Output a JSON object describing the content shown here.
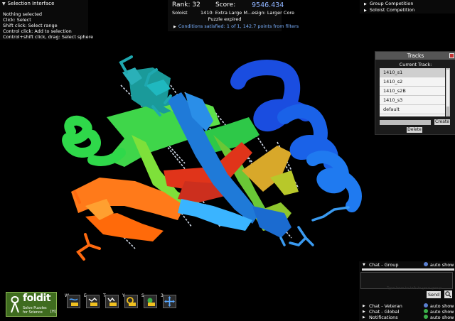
{
  "selection": {
    "title": "Selection Interface",
    "lines": [
      "Nothing selected",
      "Click: Select",
      "Shift click: Select range",
      "Control click: Add to selection",
      "Control+shift click, drag: Select sphere"
    ]
  },
  "score": {
    "rank": "Rank: 32",
    "label": "Score:",
    "value": "9546.434",
    "mode": "Soloist",
    "puzzle": "1410: Extra Large M...esign: Larger Core",
    "status": "Puzzle expired",
    "conditions": "Conditions satisfied: 1 of 1, 142.7 points from filters"
  },
  "competition": {
    "items": [
      "Group Competition",
      "Soloist Competition"
    ]
  },
  "tracks": {
    "title": "Tracks",
    "current_label": "Current Track:",
    "items": [
      "1410_s1",
      "1410_s2",
      "1410_s2B",
      "1410_s3",
      "default"
    ],
    "create_label": "Create",
    "delete_label": "Delete"
  },
  "chat": {
    "group": "Chat - Group",
    "veteran": "Chat - Veteran",
    "global": "Chat - Global",
    "notifications": "Notifications",
    "auto_show": "auto show",
    "send_label": "Send",
    "hint": "Type here to talk to your group"
  },
  "logo": {
    "name": "foldit",
    "line1": "Solve Puzzles",
    "line2": "for Science",
    "key": "[H]"
  },
  "tools": [
    {
      "key": "W",
      "icon": "wiggle-icon"
    },
    {
      "key": "E",
      "icon": "wiggle-sidechains-icon"
    },
    {
      "key": "T",
      "icon": "shake-icon"
    },
    {
      "key": "Y",
      "icon": "undo-icon"
    },
    {
      "key": "S",
      "icon": "rebuild-icon"
    },
    {
      "key": "3",
      "icon": "move-icon"
    }
  ],
  "colors": {
    "score_blue": "#8fb4ff",
    "close_red": "#c43232",
    "logo_green": "#3f6c1f"
  }
}
